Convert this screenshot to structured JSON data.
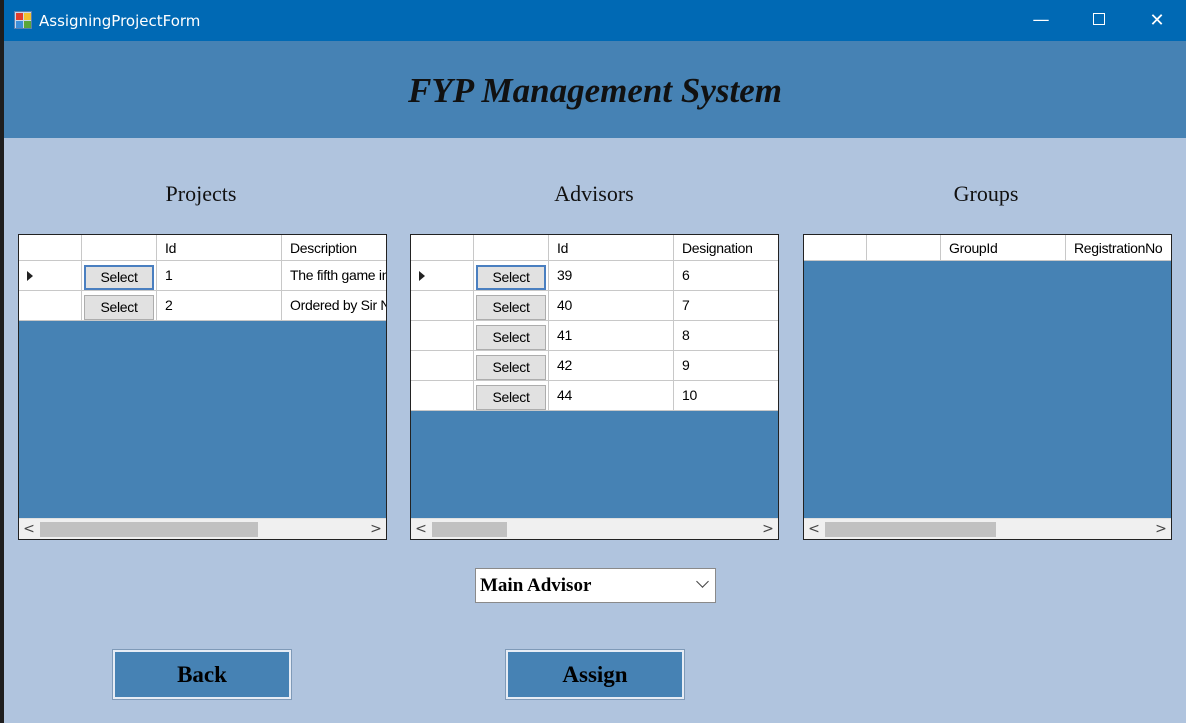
{
  "window": {
    "title": "AssigningProjectForm",
    "controls": {
      "minimize": "—",
      "close": "✕"
    }
  },
  "header": {
    "title": "FYP Management System"
  },
  "projects": {
    "title": "Projects",
    "columns": [
      "",
      "",
      "Id",
      "Description"
    ],
    "rows": [
      {
        "button": "Select",
        "id": "1",
        "description": "The fifth game in",
        "current": true
      },
      {
        "button": "Select",
        "id": "2",
        "description": "Ordered by Sir N",
        "current": false
      }
    ],
    "scroll": {
      "left": "<",
      "right": ">"
    }
  },
  "advisors": {
    "title": "Advisors",
    "columns": [
      "",
      "",
      "Id",
      "Designation"
    ],
    "rows": [
      {
        "button": "Select",
        "id": "39",
        "designation": "6",
        "current": true
      },
      {
        "button": "Select",
        "id": "40",
        "designation": "7",
        "current": false
      },
      {
        "button": "Select",
        "id": "41",
        "designation": "8",
        "current": false
      },
      {
        "button": "Select",
        "id": "42",
        "designation": "9",
        "current": false
      },
      {
        "button": "Select",
        "id": "44",
        "designation": "10",
        "current": false
      }
    ],
    "scroll": {
      "left": "<",
      "right": ">"
    }
  },
  "groups": {
    "title": "Groups",
    "columns": [
      "",
      "",
      "GroupId",
      "RegistrationNo"
    ],
    "rows": [],
    "scroll": {
      "left": "<",
      "right": ">"
    }
  },
  "advisor_role_select": {
    "selected": "Main Advisor"
  },
  "buttons": {
    "back": "Back",
    "assign": "Assign"
  },
  "colors": {
    "titlebar": "#0069b4",
    "header": "#4682b4",
    "background": "#b0c4de",
    "grid_empty": "#4682b4"
  }
}
